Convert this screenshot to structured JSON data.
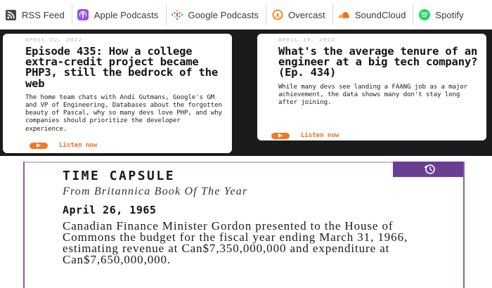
{
  "podcasts": [
    {
      "label": "RSS Feed",
      "icon": "rss-icon"
    },
    {
      "label": "Apple Podcasts",
      "icon": "apple-podcasts-icon"
    },
    {
      "label": "Google Podcasts",
      "icon": "google-podcasts-icon"
    },
    {
      "label": "Overcast",
      "icon": "overcast-icon"
    },
    {
      "label": "SoundCloud",
      "icon": "soundcloud-icon"
    },
    {
      "label": "Spotify",
      "icon": "spotify-icon"
    }
  ],
  "colors": {
    "band": "#1b1b1d",
    "accent_orange": "#f26a1b",
    "capsule_purple": "#6a3f91"
  },
  "episodes": [
    {
      "date": "APRIL 22, 2022",
      "title": "Episode 435: How a college extra-credit project became PHP3, still the bedrock of the web",
      "description": "The home team chats with Andi Gutmans, Google's GM and VP of Engineering, Databases about the forgotten beauty of Pascal, why so many devs love PHP, and why companies should prioritize the developer experience.",
      "listen_label": "Listen now"
    },
    {
      "date": "APRIL 19, 2022",
      "title": "What's the average tenure of an engineer at a big tech company? (Ep. 434)",
      "description": "While many devs see landing a FAANG job as a major achievement, the data shows many don't stay long after joining.",
      "listen_label": "Listen now"
    }
  ],
  "capsule": {
    "title": "TIME CAPSULE",
    "subtitle": "From Britannica Book Of The Year",
    "date": "April 26, 1965",
    "body": "Canadian Finance Minister Gordon presented to the House of Commons the budget for the fiscal year ending March 31, 1966, estimating revenue at Can$7,350,000,000 and expenditure at Can$7,650,000,000."
  }
}
